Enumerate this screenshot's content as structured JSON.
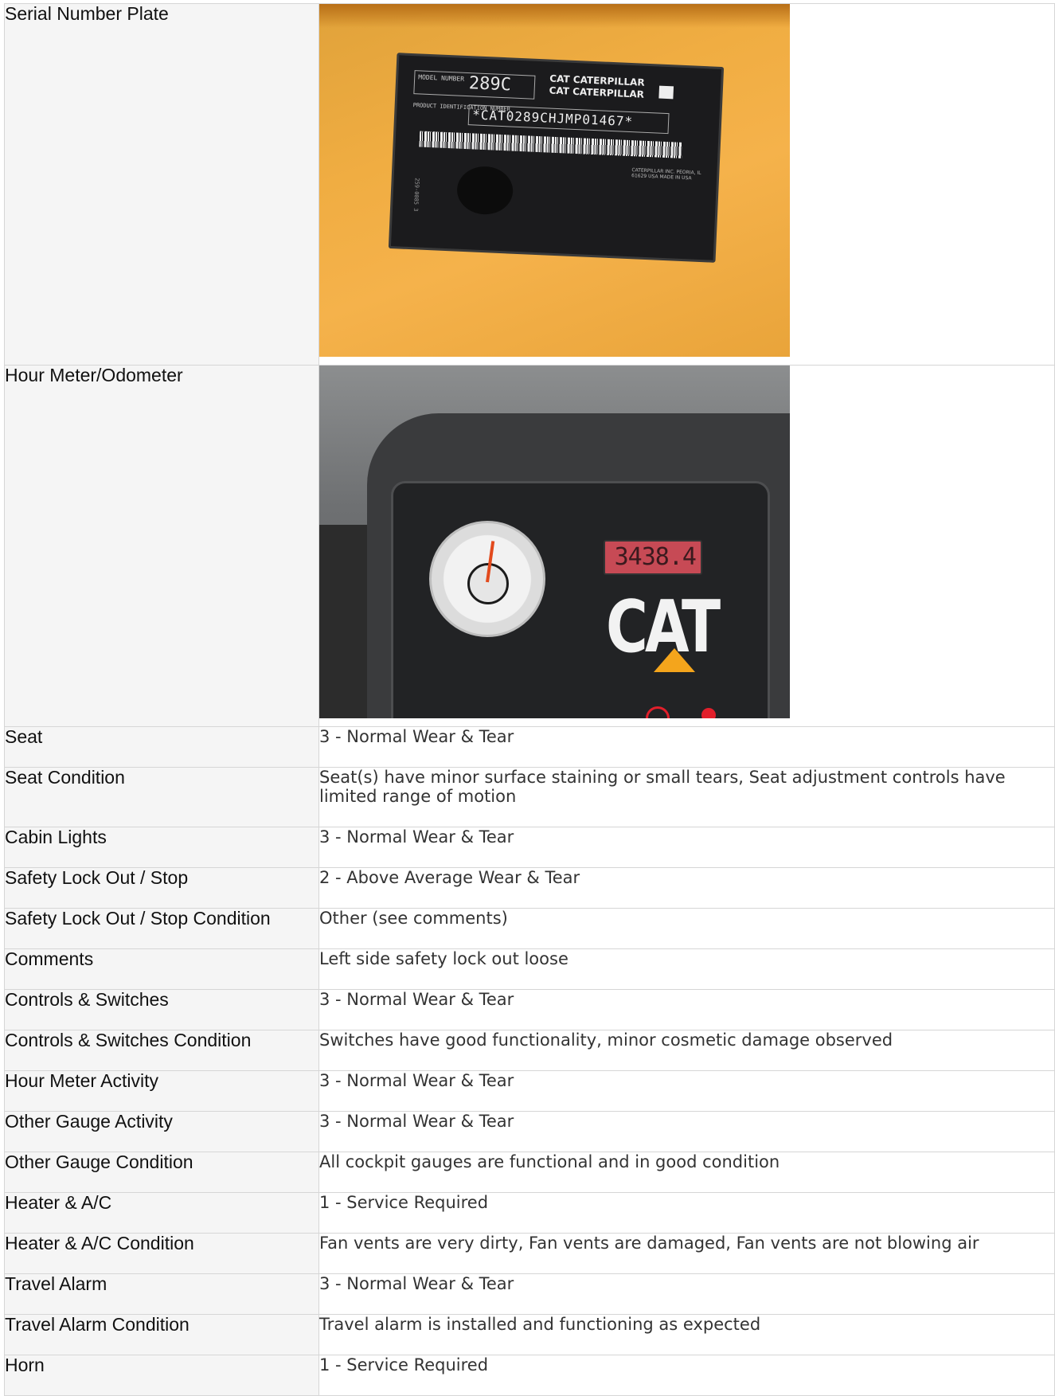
{
  "rows": [
    {
      "type": "photo",
      "label": "Serial Number Plate",
      "photo": "serial-plate"
    },
    {
      "type": "photo",
      "label": "Hour Meter/Odometer",
      "photo": "hour-meter"
    },
    {
      "type": "text",
      "label": "Seat",
      "value": "3 - Normal Wear & Tear"
    },
    {
      "type": "text",
      "label": "Seat Condition",
      "value": "Seat(s) have minor surface staining or small tears, Seat adjustment controls have limited range of motion"
    },
    {
      "type": "text",
      "label": "Cabin Lights",
      "value": "3 - Normal Wear & Tear"
    },
    {
      "type": "text",
      "label": "Safety Lock Out / Stop",
      "value": "2 - Above Average Wear & Tear"
    },
    {
      "type": "text",
      "label": "Safety Lock Out / Stop Condition",
      "value": "Other (see comments)"
    },
    {
      "type": "text",
      "label": "Comments",
      "value": "Left side safety lock out loose"
    },
    {
      "type": "text",
      "label": "Controls & Switches",
      "value": "3 - Normal Wear & Tear"
    },
    {
      "type": "text",
      "label": "Controls & Switches Condition",
      "value": "Switches have good functionality, minor cosmetic damage observed"
    },
    {
      "type": "text",
      "label": "Hour Meter Activity",
      "value": "3 - Normal Wear & Tear"
    },
    {
      "type": "text",
      "label": "Other Gauge Activity",
      "value": "3 - Normal Wear & Tear"
    },
    {
      "type": "text",
      "label": "Other Gauge Condition",
      "value": "All cockpit gauges are functional and in good condition"
    },
    {
      "type": "text",
      "label": "Heater & A/C",
      "value": "1 - Service Required"
    },
    {
      "type": "text",
      "label": "Heater & A/C Condition",
      "value": "Fan vents are very dirty, Fan vents are damaged, Fan vents are not blowing air"
    },
    {
      "type": "text",
      "label": "Travel Alarm",
      "value": "3 - Normal Wear & Tear"
    },
    {
      "type": "text",
      "label": "Travel Alarm Condition",
      "value": "Travel alarm is installed and functioning as expected"
    },
    {
      "type": "text",
      "label": "Horn",
      "value": "1 - Service Required"
    }
  ],
  "plate": {
    "model_label": "MODEL NUMBER",
    "model_number": "289C",
    "brand_line1": "CAT   CATERPILLAR",
    "brand_line2": "CAT   CATERPILLAR",
    "pin_label": "PRODUCT IDENTIFICATION NUMBER",
    "pin": "*CAT0289CHJMP01467*",
    "maker": "CATERPILLAR INC. PEORIA, IL 61629 USA MADE IN USA",
    "side_code": "259-0085 3"
  },
  "meter": {
    "hours_reading": "3438.4",
    "brand": "CAT"
  },
  "colors": {
    "label_bg": "#f5f5f5",
    "border": "#d6d6d6",
    "plate_orange": "#f0ad42",
    "cat_yellow": "#f4a51c"
  }
}
